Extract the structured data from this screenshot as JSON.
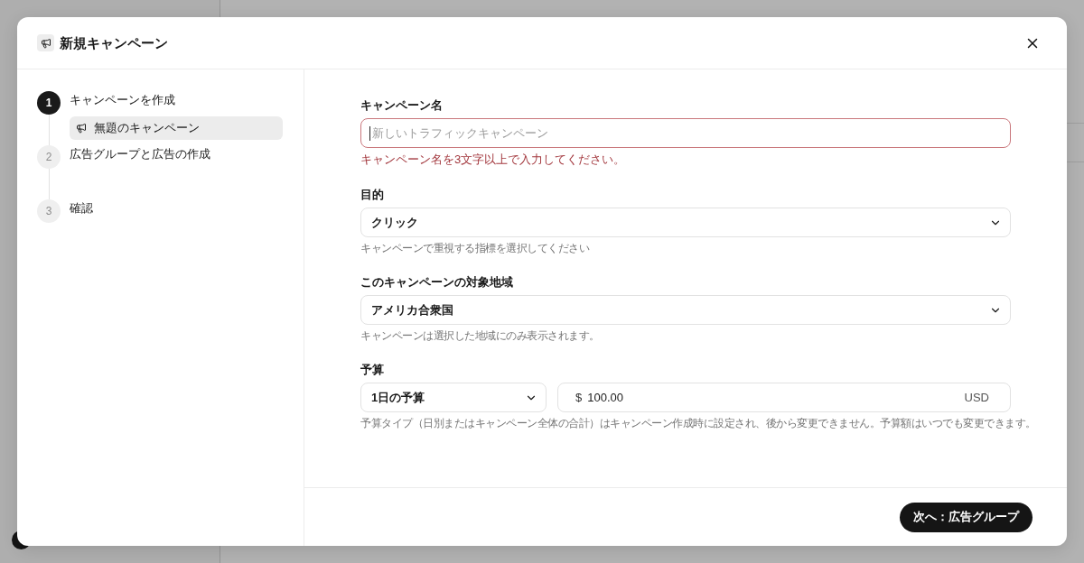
{
  "dialog": {
    "title": "新規キャンペーン"
  },
  "steps": [
    {
      "number": "1",
      "label": "キャンペーンを作成",
      "selected": true,
      "children": [
        {
          "label": "無題のキャンペーン",
          "selected": true
        }
      ]
    },
    {
      "number": "2",
      "label": "広告グループと広告の作成",
      "selected": false
    },
    {
      "number": "3",
      "label": "確認",
      "selected": false
    }
  ],
  "form": {
    "fields": [
      {
        "kind": "text",
        "label": "キャンペーン名",
        "placeholder": "新しいトラフィックキャンペーン",
        "focused": true,
        "invalid": true,
        "error": "キャンペーン名を3文字以上で入力してください。"
      },
      {
        "kind": "select",
        "label": "目的",
        "value": "クリック",
        "hint": "キャンペーンで重視する指標を選択してください"
      },
      {
        "kind": "select",
        "label": "このキャンペーンの対象地域",
        "value": "アメリカ合衆国",
        "hint": "キャンペーンは選択した地域にのみ表示されます。"
      },
      {
        "kind": "budget",
        "label": "予算",
        "budget_type": "1日の予算",
        "currency_symbol": "$",
        "amount": "100.00",
        "currency": "USD",
        "hint": "予算タイプ（日別またはキャンペーン全体の合計）はキャンペーン作成時に設定され、後から変更できません。予算額はいつでも変更できます。"
      }
    ]
  },
  "footer": {
    "next_button": "次へ：広告グループ"
  }
}
